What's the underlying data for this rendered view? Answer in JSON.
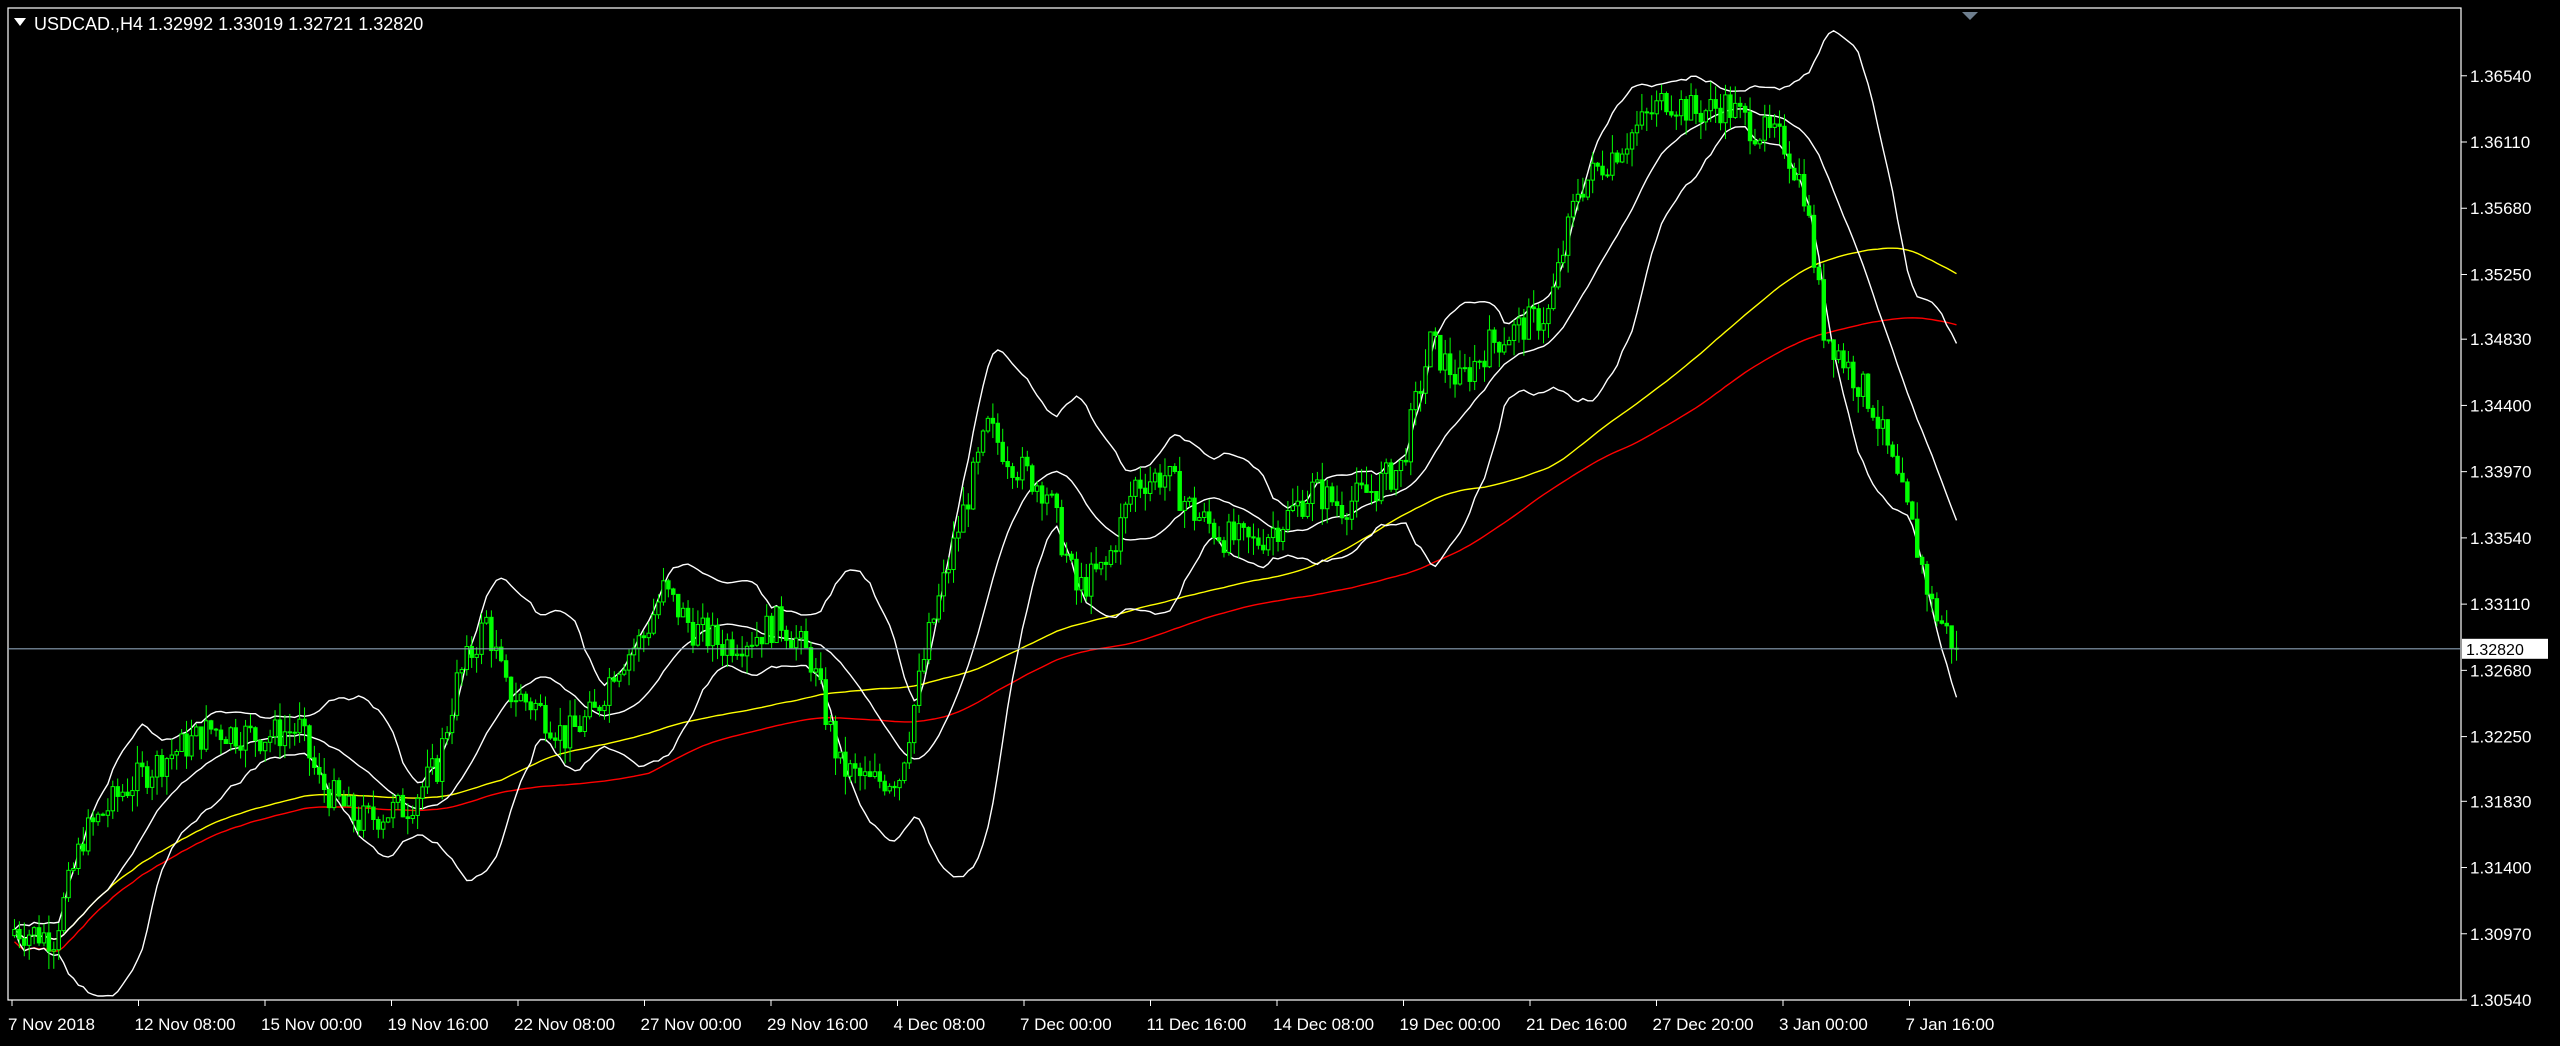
{
  "header": {
    "symbol": "USDCAD.",
    "timeframe": "H4",
    "ohlc": "1.32992 1.33019 1.32721 1.32820",
    "title_text": "USDCAD.,H4  1.32992 1.33019 1.32721 1.32820"
  },
  "price_axis": {
    "labels": [
      "1.36540",
      "1.36110",
      "1.35680",
      "1.35250",
      "1.34830",
      "1.34400",
      "1.33970",
      "1.33540",
      "1.33110",
      "1.32680",
      "1.32250",
      "1.31830",
      "1.31400",
      "1.30970",
      "1.30540"
    ],
    "current_price": "1.32820"
  },
  "time_axis": {
    "labels": [
      "7 Nov 2018",
      "12 Nov 08:00",
      "15 Nov 00:00",
      "19 Nov 16:00",
      "22 Nov 08:00",
      "27 Nov 00:00",
      "29 Nov 16:00",
      "4 Dec 08:00",
      "7 Dec 00:00",
      "11 Dec 16:00",
      "14 Dec 08:00",
      "19 Dec 00:00",
      "21 Dec 16:00",
      "27 Dec 20:00",
      "3 Jan 00:00",
      "7 Jan 16:00"
    ]
  },
  "colors": {
    "background": "#000000",
    "bull_candle": "#00ff00",
    "bear_candle": "#00ff00",
    "bollinger": "#ffffff",
    "ma_yellow": "#ffff00",
    "ma_red": "#ff0000",
    "grid_line": "#8aa0b4",
    "axis": "#ffffff"
  },
  "chart_data": {
    "type": "candlestick",
    "symbol": "USDCAD.",
    "timeframe": "H4",
    "ylim": [
      1.3054,
      1.3698
    ],
    "current_price": 1.3282,
    "price_path": [
      [
        0,
        1.31
      ],
      [
        8,
        1.3095
      ],
      [
        14,
        1.316
      ],
      [
        22,
        1.319
      ],
      [
        30,
        1.321
      ],
      [
        40,
        1.323
      ],
      [
        50,
        1.3225
      ],
      [
        58,
        1.323
      ],
      [
        62,
        1.3195
      ],
      [
        70,
        1.317
      ],
      [
        80,
        1.318
      ],
      [
        86,
        1.3205
      ],
      [
        90,
        1.326
      ],
      [
        96,
        1.33
      ],
      [
        100,
        1.3255
      ],
      [
        106,
        1.3245
      ],
      [
        112,
        1.3225
      ],
      [
        118,
        1.324
      ],
      [
        122,
        1.327
      ],
      [
        128,
        1.329
      ],
      [
        132,
        1.332
      ],
      [
        138,
        1.3295
      ],
      [
        144,
        1.3285
      ],
      [
        150,
        1.329
      ],
      [
        156,
        1.33
      ],
      [
        162,
        1.3275
      ],
      [
        168,
        1.3205
      ],
      [
        174,
        1.3195
      ],
      [
        180,
        1.32
      ],
      [
        186,
        1.329
      ],
      [
        192,
        1.336
      ],
      [
        198,
        1.3425
      ],
      [
        204,
        1.34
      ],
      [
        210,
        1.3385
      ],
      [
        216,
        1.332
      ],
      [
        222,
        1.3335
      ],
      [
        228,
        1.339
      ],
      [
        234,
        1.3395
      ],
      [
        240,
        1.337
      ],
      [
        246,
        1.3355
      ],
      [
        252,
        1.335
      ],
      [
        258,
        1.3365
      ],
      [
        264,
        1.3385
      ],
      [
        270,
        1.3375
      ],
      [
        276,
        1.3385
      ],
      [
        282,
        1.34
      ],
      [
        288,
        1.348
      ],
      [
        294,
        1.3455
      ],
      [
        300,
        1.348
      ],
      [
        306,
        1.349
      ],
      [
        312,
        1.35
      ],
      [
        318,
        1.358
      ],
      [
        324,
        1.36
      ],
      [
        330,
        1.362
      ],
      [
        336,
        1.364
      ],
      [
        342,
        1.363
      ],
      [
        348,
        1.3635
      ],
      [
        354,
        1.362
      ],
      [
        360,
        1.361
      ],
      [
        364,
        1.358
      ],
      [
        368,
        1.349
      ],
      [
        372,
        1.347
      ],
      [
        378,
        1.344
      ],
      [
        382,
        1.34
      ],
      [
        386,
        1.336
      ],
      [
        390,
        1.331
      ],
      [
        395,
        1.3282
      ]
    ],
    "n_bars": 396,
    "series": [
      {
        "name": "Bollinger Upper",
        "color": "#ffffff"
      },
      {
        "name": "Bollinger Middle",
        "color": "#ffffff"
      },
      {
        "name": "Bollinger Lower",
        "color": "#ffffff"
      },
      {
        "name": "MA Yellow",
        "color": "#ffff00"
      },
      {
        "name": "MA Red",
        "color": "#ff0000"
      }
    ],
    "time_labels": [
      "7 Nov 2018",
      "12 Nov 08:00",
      "15 Nov 00:00",
      "19 Nov 16:00",
      "22 Nov 08:00",
      "27 Nov 00:00",
      "29 Nov 16:00",
      "4 Dec 08:00",
      "7 Dec 00:00",
      "11 Dec 16:00",
      "14 Dec 08:00",
      "19 Dec 00:00",
      "21 Dec 16:00",
      "27 Dec 20:00",
      "3 Jan 00:00",
      "7 Jan 16:00"
    ],
    "price_labels": [
      "1.36540",
      "1.36110",
      "1.35680",
      "1.35250",
      "1.34830",
      "1.34400",
      "1.33970",
      "1.33540",
      "1.33110",
      "1.32680",
      "1.32250",
      "1.31830",
      "1.31400",
      "1.30970",
      "1.30540"
    ]
  }
}
